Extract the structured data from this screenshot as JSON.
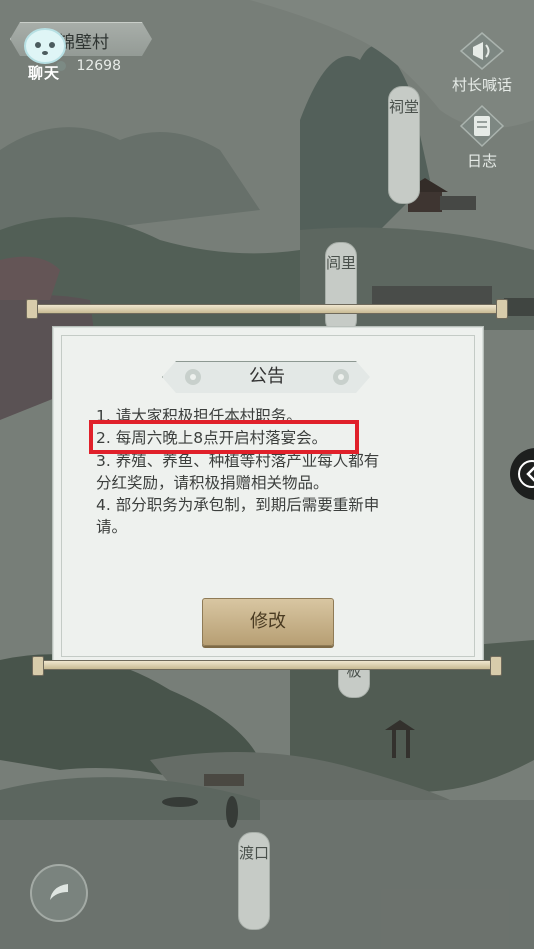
{
  "hud": {
    "chat_label": "聊天",
    "village_name": "锦壁村",
    "population": "12698"
  },
  "side_buttons": {
    "chief_shout": "村长喊话",
    "log": "日志"
  },
  "map_labels": {
    "ancestral_hall": "祠堂",
    "neighborhood": "闾里",
    "ferry": "渡口",
    "board_fragment": "板"
  },
  "notice": {
    "title": "公告",
    "lines": [
      "1. 请大家积极担任本村职务。",
      "2. 每周六晚上8点开启村落宴会。",
      "3. 养殖、养鱼、种植等村落产业每人都有",
      "分红奖励，请积极捐赠相关物品。",
      "4. 部分职务为承包制，到期后需要重新申",
      "请。"
    ],
    "edit_button": "修改"
  },
  "colors": {
    "highlight": "#e0202a",
    "button": "#c8b48c",
    "panel": "#eef1ee"
  }
}
